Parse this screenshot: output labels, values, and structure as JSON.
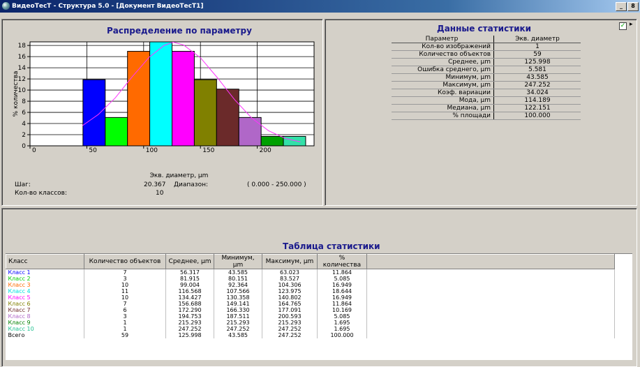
{
  "window": {
    "title": "ВидеоТесТ - Структура 5.0 - [Документ ВидеоТесТ1]",
    "controls": [
      "_",
      "8"
    ]
  },
  "histogram_panel": {
    "title": "Распределение по параметру",
    "step_label": "Шаг:",
    "step_value": "20.367",
    "range_label": "Диапазон:",
    "range_value": "( 0.000 - 250.000 )",
    "classes_label": "Кол-во классов:",
    "classes_value": "10"
  },
  "chart_data": {
    "type": "bar",
    "title": "Распределение по параметру",
    "xlabel": "Экв. диаметр, µm",
    "ylabel": "% количества",
    "xlim": [
      0,
      250
    ],
    "ylim": [
      0,
      18.644
    ],
    "x_ticks": [
      0,
      50,
      100,
      150,
      200
    ],
    "y_ticks": [
      0,
      2,
      4,
      6,
      8,
      10,
      12,
      14,
      16,
      18
    ],
    "bins": [
      {
        "start": 46.6,
        "end": 66.2,
        "value": 11.864,
        "color": "#0000ff"
      },
      {
        "start": 66.2,
        "end": 85.8,
        "value": 5.085,
        "color": "#00ff00"
      },
      {
        "start": 85.8,
        "end": 105.4,
        "value": 16.949,
        "color": "#ff6a00"
      },
      {
        "start": 105.4,
        "end": 125.0,
        "value": 18.644,
        "color": "#00ffff"
      },
      {
        "start": 125.0,
        "end": 144.6,
        "value": 16.949,
        "color": "#ff00ff"
      },
      {
        "start": 144.6,
        "end": 164.2,
        "value": 11.864,
        "color": "#808000"
      },
      {
        "start": 164.2,
        "end": 183.8,
        "value": 10.169,
        "color": "#6b2a2a"
      },
      {
        "start": 183.8,
        "end": 203.4,
        "value": 5.085,
        "color": "#b067c8"
      },
      {
        "start": 203.4,
        "end": 223.0,
        "value": 1.695,
        "color": "#00a000"
      },
      {
        "start": 223.0,
        "end": 242.6,
        "value": 1.695,
        "color": "#33e0a8"
      }
    ],
    "fit_curve": {
      "color": "#ff33ff",
      "points": [
        [
          46,
          3.6
        ],
        [
          60,
          5.6
        ],
        [
          75,
          8.6
        ],
        [
          90,
          12.4
        ],
        [
          105,
          15.9
        ],
        [
          118,
          18.0
        ],
        [
          126,
          18.6
        ],
        [
          135,
          18.1
        ],
        [
          150,
          15.8
        ],
        [
          165,
          12.2
        ],
        [
          180,
          8.3
        ],
        [
          195,
          5.0
        ],
        [
          210,
          2.7
        ],
        [
          225,
          1.3
        ],
        [
          238,
          0.7
        ]
      ]
    },
    "grid": true
  },
  "stats_panel": {
    "title": "Данные статистики",
    "header": [
      "Параметр",
      "Экв. диаметр"
    ],
    "rows": [
      [
        "Кол-во изображений",
        "1"
      ],
      [
        "Количество объектов",
        "59"
      ],
      [
        "Среднее, µm",
        "125.998"
      ],
      [
        "Ошибка среднего, µm",
        "5.581"
      ],
      [
        "Минимум, µm",
        "43.585"
      ],
      [
        "Максимум, µm",
        "247.252"
      ],
      [
        "Коэф. вариации",
        "34.024"
      ],
      [
        "Мода, µm",
        "114.189"
      ],
      [
        "Медиана, µm",
        "122.151"
      ],
      [
        "% площади",
        "100.000"
      ]
    ],
    "checkbox_mark": "✓"
  },
  "table_panel": {
    "title": "Таблица статистики",
    "columns": [
      "Класс",
      "Количество объектов",
      "Среднее, µm",
      "Минимум, µm",
      "Максимум, µm",
      "% количества"
    ],
    "rows": [
      {
        "cells": [
          "Класс 1",
          "7",
          "56.317",
          "43.585",
          "63.023",
          "11.864"
        ],
        "color": "#0000ff"
      },
      {
        "cells": [
          "Класс 2",
          "3",
          "81.915",
          "80.151",
          "83.527",
          "5.085"
        ],
        "color": "#00cc00"
      },
      {
        "cells": [
          "Класс 3",
          "10",
          "99.004",
          "92.364",
          "104.306",
          "16.949"
        ],
        "color": "#ff6a00"
      },
      {
        "cells": [
          "Класс 4",
          "11",
          "116.568",
          "107.566",
          "123.975",
          "18.644"
        ],
        "color": "#00e0e0"
      },
      {
        "cells": [
          "Класс 5",
          "10",
          "134.427",
          "130.358",
          "140.802",
          "16.949"
        ],
        "color": "#ff00ff"
      },
      {
        "cells": [
          "Класс 6",
          "7",
          "156.688",
          "149.141",
          "164.765",
          "11.864"
        ],
        "color": "#808000"
      },
      {
        "cells": [
          "Класс 7",
          "6",
          "172.290",
          "166.330",
          "177.091",
          "10.169"
        ],
        "color": "#6b2a2a"
      },
      {
        "cells": [
          "Класс 8",
          "3",
          "194.753",
          "187.511",
          "200.593",
          "5.085"
        ],
        "color": "#b067c8"
      },
      {
        "cells": [
          "Класс 9",
          "1",
          "215.293",
          "215.293",
          "215.293",
          "1.695"
        ],
        "color": "#008000"
      },
      {
        "cells": [
          "Класс 10",
          "1",
          "247.252",
          "247.252",
          "247.252",
          "1.695"
        ],
        "color": "#20c090"
      },
      {
        "cells": [
          "Всего",
          "59",
          "125.998",
          "43.585",
          "247.252",
          "100.000"
        ],
        "color": "#000000"
      }
    ]
  }
}
